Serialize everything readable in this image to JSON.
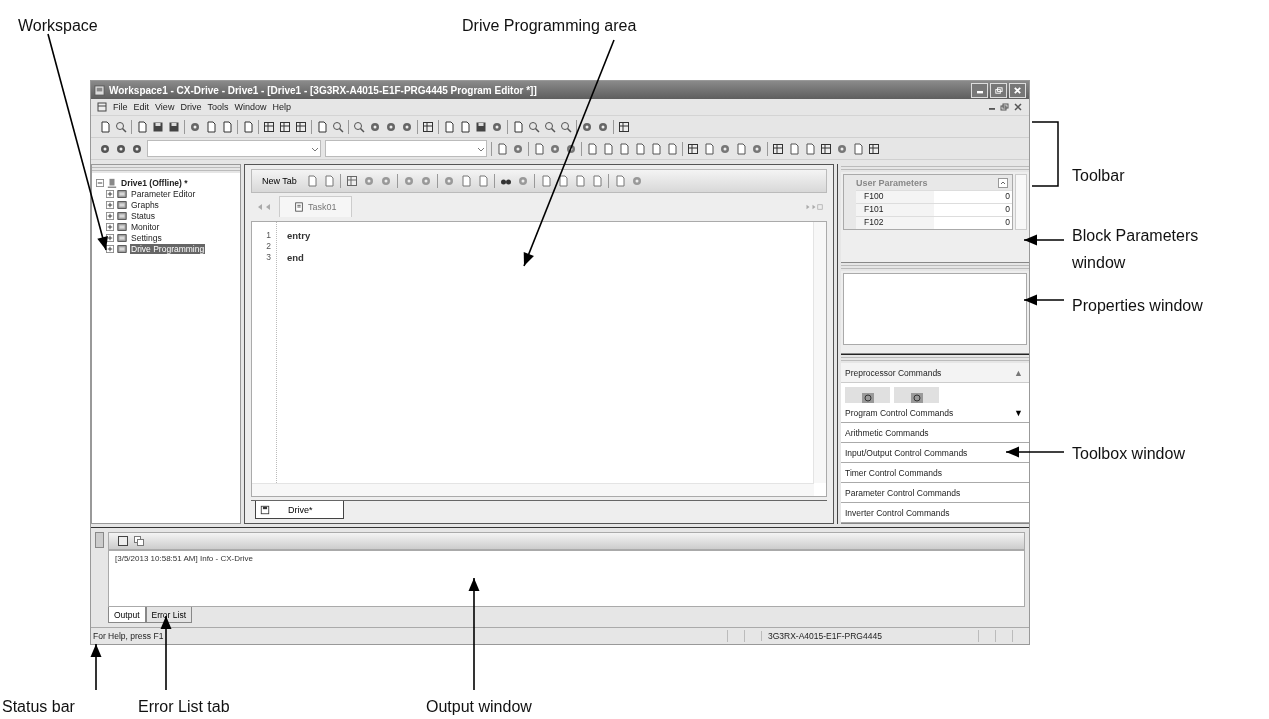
{
  "window": {
    "title": "Workspace1 - CX-Drive - Drive1 - [Drive1 - [3G3RX-A4015-E1F-PRG4445 Program Editor *]]"
  },
  "menu": [
    "File",
    "Edit",
    "View",
    "Drive",
    "Tools",
    "Window",
    "Help"
  ],
  "workspace": {
    "root": {
      "label": "Drive1 (Offline) *",
      "expanded": true,
      "children": [
        {
          "label": "Parameter Editor",
          "selected": false
        },
        {
          "label": "Graphs",
          "selected": false
        },
        {
          "label": "Status",
          "selected": false
        },
        {
          "label": "Monitor",
          "selected": false
        },
        {
          "label": "Settings",
          "selected": false
        },
        {
          "label": "Drive Programming",
          "selected": true
        }
      ]
    }
  },
  "editor": {
    "new_tab_label": "New Tab",
    "tabs": [
      {
        "label": "Task01",
        "selected": true
      }
    ],
    "lines": [
      {
        "number": "1",
        "text": "entry"
      },
      {
        "number": "2"
      },
      {
        "number": "3",
        "text": "end"
      }
    ],
    "document_tabs": [
      {
        "label": "Drive*",
        "selected": true
      }
    ]
  },
  "block_parameters": {
    "title": "User Parameters",
    "rows": [
      {
        "name": "F100",
        "value": "0"
      },
      {
        "name": "F101",
        "value": "0"
      },
      {
        "name": "F102",
        "value": "0"
      }
    ]
  },
  "toolbox": {
    "sections": [
      {
        "label": "Preprocessor Commands",
        "arrow": "▲",
        "expanded": true
      },
      {
        "label": "Program Control Commands",
        "arrow": "▼",
        "expanded": false
      },
      {
        "label": "Arithmetic Commands",
        "expanded": false
      },
      {
        "label": "Input/Output Control Commands",
        "expanded": false
      },
      {
        "label": "Timer Control Commands",
        "expanded": false
      },
      {
        "label": "Parameter Control Commands",
        "expanded": false
      },
      {
        "label": "Inverter Control Commands",
        "expanded": false
      }
    ]
  },
  "output": {
    "lines": [
      "[3/5/2013 10:58:51 AM] Info - CX-Drive"
    ],
    "tabs": [
      {
        "label": "Output",
        "selected": true
      },
      {
        "label": "Error List",
        "selected": false
      }
    ]
  },
  "status_bar": {
    "help": "For Help, press F1",
    "drive": "3G3RX-A4015-E1F-PRG4445"
  },
  "annotations": [
    {
      "label": "Workspace"
    },
    {
      "label": "Drive Programming area"
    },
    {
      "label": "Toolbar"
    },
    {
      "label": "Block Parameters window"
    },
    {
      "label": "Properties window"
    },
    {
      "label": "Toolbox window"
    },
    {
      "label": "Status bar"
    },
    {
      "label": "Error List tab"
    },
    {
      "label": "Output window"
    }
  ]
}
